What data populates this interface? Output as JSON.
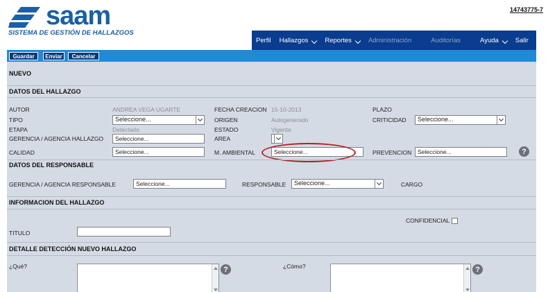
{
  "logo": {
    "word": "saam",
    "subtitle": "SISTEMA DE GESTIÓN DE HALLAZGOS"
  },
  "user_id": "14743775-7",
  "nav": {
    "perfil": "Perfil",
    "hallazgos": "Hallazgos",
    "reportes": "Reportes",
    "administracion": "Administración",
    "auditorias": "Auditorías",
    "ayuda": "Ayuda",
    "salir": "Salir"
  },
  "toolbar": {
    "guardar": "Guardar",
    "enviar": "Enviar",
    "cancelar": "Cancelar"
  },
  "form": {
    "nuevo": "NUEVO",
    "datos_hallazgo": "DATOS DEL HALLAZGO",
    "autor_label": "AUTOR",
    "autor_value": "ANDREA VEGA UGARTE",
    "fecha_label": "FECHA CREACION",
    "fecha_value": "15-10-2013",
    "plazo_label": "PLAZO",
    "tipo_label": "TIPO",
    "tipo_value": "Seleccione...",
    "origen_label": "ORIGEN",
    "origen_value": "Autogenerado",
    "criticidad_label": "CRITICIDAD",
    "criticidad_value": "Seleccione...",
    "etapa_label": "ETAPA",
    "etapa_value": "Detectado",
    "estado_label": "ESTADO",
    "estado_value": "Vigente",
    "gerencia_label": "GERENCIA / AGENCIA HALLAZGO",
    "gerencia_value": "Seleccione...",
    "area_label": "AREA",
    "area_value": "",
    "calidad_label": "CALIDAD",
    "calidad_value": "Seleccione...",
    "ambiental_label": "M. AMBIENTAL",
    "ambiental_value": "Seleccione...",
    "prevencion_label": "PREVENCION",
    "prevencion_value": "Seleccione...",
    "datos_responsable": "DATOS DEL RESPONSABLE",
    "gerencia_resp_label": "GERENCIA / AGENCIA RESPONSABLE",
    "gerencia_resp_value": "Seleccione...",
    "responsable_label": "RESPONSABLE",
    "responsable_value": "Seleccione...",
    "cargo_label": "CARGO",
    "informacion": "INFORMACION DEL HALLAZGO",
    "confidencial_label": "CONFIDENCIAL",
    "titulo_label": "TITULO",
    "titulo_value": "",
    "detalle": "DETALLE DETECCIÓN NUEVO HALLAZGO",
    "que_label": "¿Qué?",
    "como_label": "¿Cómo?",
    "help_glyph": "?"
  },
  "colors": {
    "brand": "#1a5fa8",
    "nav_bg": "#0a3d8f",
    "bar": "#1f8ad7",
    "panel": "#d5dbe4",
    "highlight": "#b21f24"
  }
}
